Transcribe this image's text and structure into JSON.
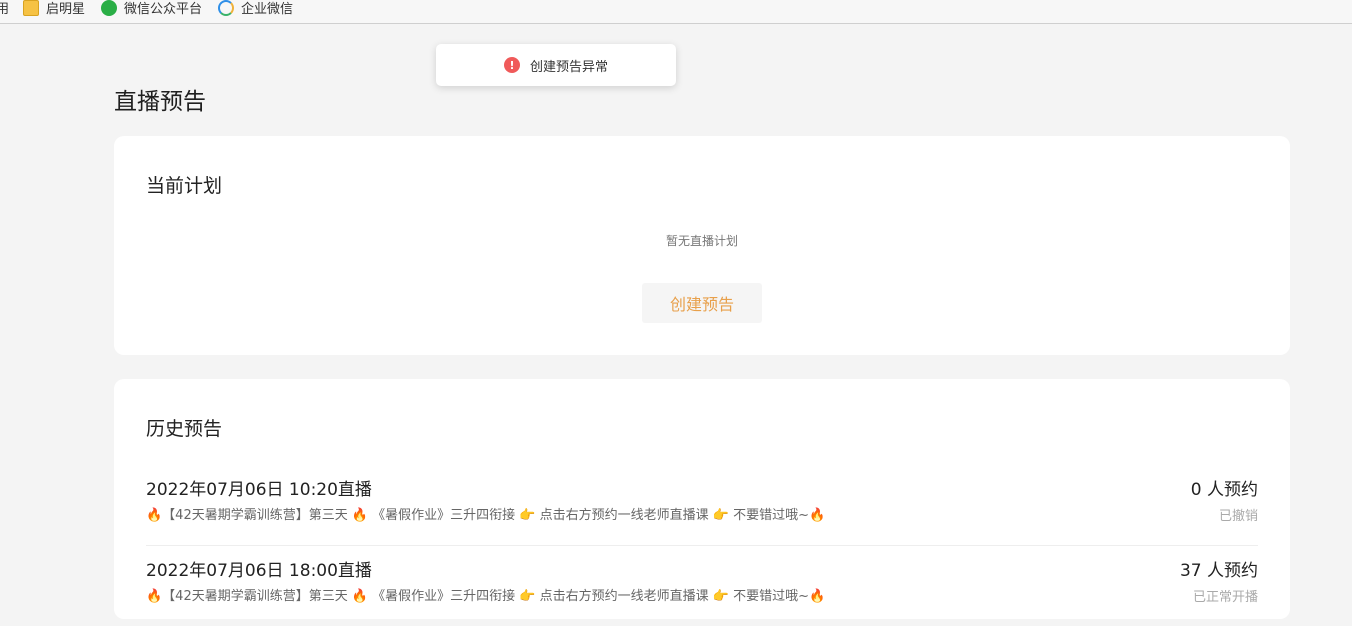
{
  "bookmarks": {
    "partial_label": "用",
    "items": [
      {
        "label": "启明星",
        "icon": "folder-icon"
      },
      {
        "label": "微信公众平台",
        "icon": "wechat-icon"
      },
      {
        "label": "企业微信",
        "icon": "wecom-icon"
      }
    ]
  },
  "toast": {
    "icon": "error-icon",
    "icon_glyph": "!",
    "message": "创建预告异常",
    "color": "#f05a5a"
  },
  "page": {
    "title": "直播预告"
  },
  "current_plan": {
    "title": "当前计划",
    "empty_text": "暂无直播计划",
    "create_label": "创建预告",
    "accent_color": "#e8a04b"
  },
  "history": {
    "title": "历史预告",
    "items": [
      {
        "time": "2022年07月06日 10:20直播",
        "description": "🔥【42天暑期学霸训练营】第三天 🔥 《暑假作业》三升四衔接 👉 点击右方预约一线老师直播课 👉 不要错过哦~🔥",
        "count": "0 人预约",
        "status": "已撤销"
      },
      {
        "time": "2022年07月06日 18:00直播",
        "description": "🔥【42天暑期学霸训练营】第三天 🔥 《暑假作业》三升四衔接 👉 点击右方预约一线老师直播课 👉 不要错过哦~🔥",
        "count": "37 人预约",
        "status": "已正常开播"
      }
    ]
  }
}
